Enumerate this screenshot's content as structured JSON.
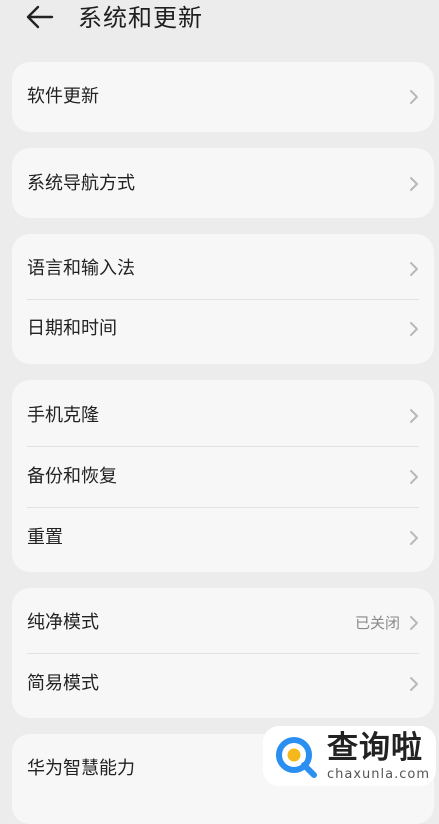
{
  "header": {
    "title": "系统和更新",
    "back_icon": "arrow-left-icon"
  },
  "groups": [
    {
      "items": [
        {
          "label": "软件更新"
        }
      ]
    },
    {
      "items": [
        {
          "label": "系统导航方式"
        }
      ]
    },
    {
      "items": [
        {
          "label": "语言和输入法"
        },
        {
          "label": "日期和时间"
        }
      ]
    },
    {
      "items": [
        {
          "label": "手机克隆"
        },
        {
          "label": "备份和恢复"
        },
        {
          "label": "重置"
        }
      ]
    },
    {
      "items": [
        {
          "label": "纯净模式",
          "value": "已关闭"
        },
        {
          "label": "简易模式"
        }
      ]
    },
    {
      "items": [
        {
          "label": "华为智慧能力"
        }
      ]
    }
  ],
  "watermark": {
    "name_cn": "查询啦",
    "domain": "chaxunla.com"
  },
  "colors": {
    "background": "#ececec",
    "card": "#f7f7f7",
    "divider": "#e3e3e3",
    "chevron": "#b9b9b9",
    "watermark_blue": "#2a8ff0",
    "watermark_yellow": "#f5b81c"
  }
}
